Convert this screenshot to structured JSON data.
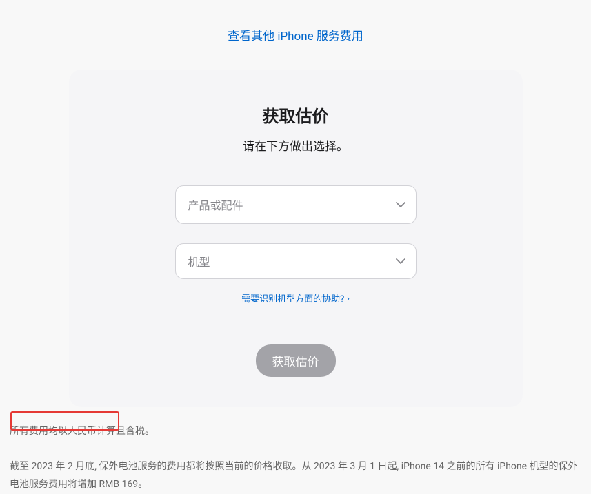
{
  "header": {
    "link_text": "查看其他 iPhone 服务费用"
  },
  "card": {
    "title": "获取估价",
    "subtitle": "请在下方做出选择。",
    "select_product_placeholder": "产品或配件",
    "select_model_placeholder": "机型",
    "help_link_text": "需要识别机型方面的协助?",
    "submit_label": "获取估价"
  },
  "footer": {
    "line1": "所有费用均以人民币计算且含税。",
    "line2": "截至 2023 年 2 月底, 保外电池服务的费用都将按照当前的价格收取。从 2023 年 3 月 1 日起, iPhone 14 之前的所有 iPhone 机型的保外电池服务费用将增加 RMB 169。"
  }
}
